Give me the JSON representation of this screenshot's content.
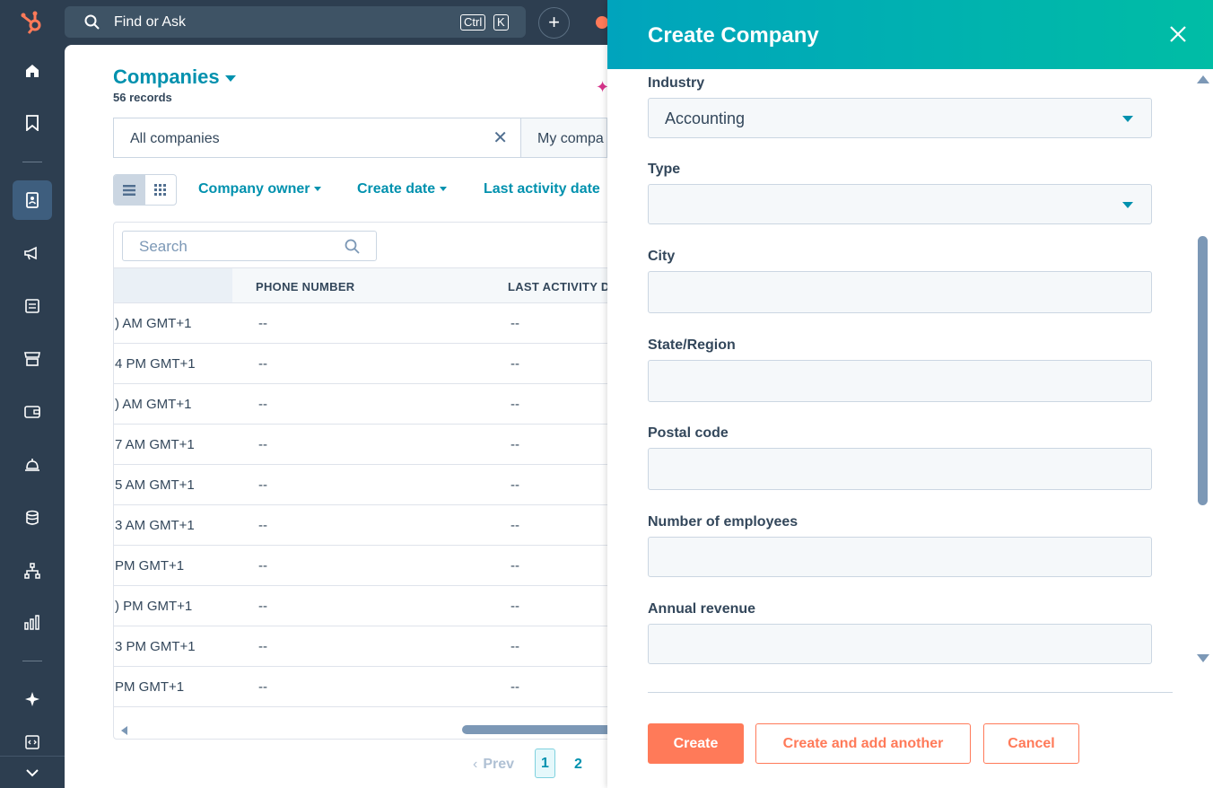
{
  "topbar": {
    "search_label": "Find or Ask",
    "kbd_ctrl": "Ctrl",
    "kbd_k": "K",
    "plus": "+"
  },
  "main": {
    "title": "Companies",
    "records": "56 records",
    "tabs": [
      {
        "label": "All companies"
      },
      {
        "label": "My compa"
      }
    ],
    "filters": [
      {
        "label": "Company owner"
      },
      {
        "label": "Create date"
      },
      {
        "label": "Last activity date"
      }
    ],
    "table": {
      "search_placeholder": "Search",
      "columns": [
        "PHONE NUMBER",
        "LAST ACTIVITY D"
      ],
      "rows": [
        {
          "created": ") AM GMT+1",
          "phone": "--",
          "last_activity": "--"
        },
        {
          "created": "4 PM GMT+1",
          "phone": "--",
          "last_activity": "--"
        },
        {
          "created": ") AM GMT+1",
          "phone": "--",
          "last_activity": "--"
        },
        {
          "created": "7 AM GMT+1",
          "phone": "--",
          "last_activity": "--"
        },
        {
          "created": "5 AM GMT+1",
          "phone": "--",
          "last_activity": "--"
        },
        {
          "created": "3 AM GMT+1",
          "phone": "--",
          "last_activity": "--"
        },
        {
          "created": " PM GMT+1",
          "phone": "--",
          "last_activity": "--"
        },
        {
          "created": ") PM GMT+1",
          "phone": "--",
          "last_activity": "--"
        },
        {
          "created": "3 PM GMT+1",
          "phone": "--",
          "last_activity": "--"
        },
        {
          "created": " PM GMT+1",
          "phone": "--",
          "last_activity": "--"
        }
      ]
    },
    "pagination": {
      "prev": "Prev",
      "current": "1",
      "next_page": "2"
    }
  },
  "panel": {
    "title": "Create Company",
    "fields": [
      {
        "label": "Industry",
        "value": "Accounting",
        "type": "select"
      },
      {
        "label": "Type",
        "value": "",
        "type": "select"
      },
      {
        "label": "City",
        "value": "",
        "type": "text"
      },
      {
        "label": "State/Region",
        "value": "",
        "type": "text"
      },
      {
        "label": "Postal code",
        "value": "",
        "type": "text"
      },
      {
        "label": "Number of employees",
        "value": "",
        "type": "text"
      },
      {
        "label": "Annual revenue",
        "value": "",
        "type": "text"
      }
    ],
    "buttons": {
      "create": "Create",
      "create_another": "Create and add another",
      "cancel": "Cancel"
    }
  },
  "colors": {
    "accent": "#0091ae",
    "primary_button": "#ff7a59",
    "nav_bg": "#2d3e50",
    "header_gradient_start": "#00a4bd",
    "header_gradient_end": "#00bda5"
  },
  "icons": {
    "nav": [
      "home-icon",
      "bookmark-icon",
      "contacts-icon",
      "marketing-icon",
      "content-icon",
      "commerce-icon",
      "wallet-icon",
      "service-icon",
      "data-icon",
      "automation-icon",
      "reporting-icon",
      "ai-sparkle-icon",
      "developer-icon"
    ]
  }
}
